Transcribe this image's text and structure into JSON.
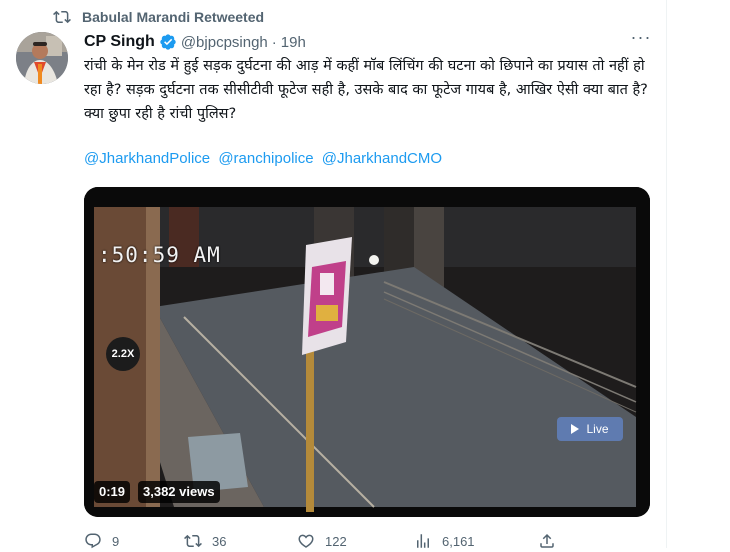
{
  "retweet": {
    "text": "Babulal Marandi Retweeted",
    "icon": "retweet-icon"
  },
  "author": {
    "name": "CP Singh",
    "handle": "@bjpcpsingh",
    "separator": "·",
    "time": "19h",
    "verified_color": "#1d9bf0",
    "avatar_icon": "profile-photo"
  },
  "tweet": {
    "text": "रांची के मेन रोड में हुई सड़क दुर्घटना की आड़ में कहीं मॉब लिंचिंग की घटना को छिपाने का प्रयास तो नहीं हो रहा है? सड़क दुर्घटना तक सीसीटीवी फूटेज सही है, उसके बाद का फूटेज गायब है, आखिर ऐसी क्या बात है? क्या छुपा रही है रांची पुलिस?",
    "mentions": [
      "@JharkhandPolice",
      "@ranchipolice",
      "@JharkhandCMO"
    ],
    "link_color": "#1d9bf0"
  },
  "video": {
    "timestamp": ":50:59 AM",
    "zoom": "2.2X",
    "live_label": "Live",
    "duration": "0:19",
    "views": "3,382 views"
  },
  "actions": {
    "replies": "9",
    "retweets": "36",
    "likes": "122",
    "views": "6,161",
    "icons": [
      "reply-icon",
      "retweet-icon",
      "like-icon",
      "analytics-icon",
      "share-icon"
    ]
  },
  "colors": {
    "muted": "#536471",
    "text": "#0f1419",
    "accent": "#1d9bf0"
  }
}
